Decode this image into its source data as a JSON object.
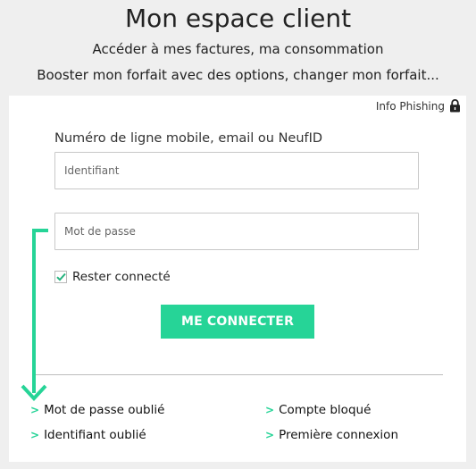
{
  "header": {
    "title": "Mon espace client",
    "subtitle_line1": "Accéder à mes factures, ma consommation",
    "subtitle_line2": "Booster mon forfait avec des options, changer mon forfait..."
  },
  "login": {
    "info_phishing": "Info Phishing",
    "id_label": "Numéro de ligne mobile, email ou NeufID",
    "id_placeholder": "Identifiant",
    "password_placeholder": "Mot de passe",
    "remember_label": "Rester connecté",
    "remember_checked": true,
    "connect_button": "ME CONNECTER"
  },
  "links": {
    "forgot_password": "Mot de passe oublié",
    "forgot_id": "Identifiant oublié",
    "account_blocked": "Compte bloqué",
    "first_login": "Première connexion",
    "chevron": ">"
  },
  "colors": {
    "accent": "#26d497",
    "background": "#efefef",
    "card": "#ffffff"
  }
}
